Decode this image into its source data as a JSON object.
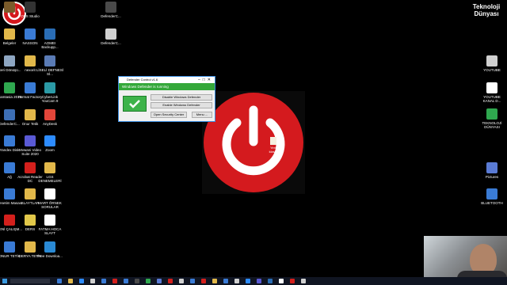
{
  "brand": {
    "line1": "Teknoloji",
    "line2": "Dünyası"
  },
  "desktop_icons": [
    {
      "label": "",
      "color": "#7a5b2a"
    },
    {
      "label": "OBS Studio",
      "color": "#333333"
    },
    {
      "label": "DefenderC...",
      "color": "#4a4a4a"
    },
    {
      "label": "Belgeler",
      "color": "#e2b84a"
    },
    {
      "label": "NASSON",
      "color": "#3a7bd5"
    },
    {
      "label": "AOMEI Backupp...",
      "color": "#2a6db5"
    },
    {
      "label": "DefenderC...",
      "color": "#d0d0d0"
    },
    {
      "label": "Geri Dönüşü...",
      "color": "#8ea6c2"
    },
    {
      "label": "nexorit",
      "color": "#e2b84a"
    },
    {
      "label": "LİSELİ DEFNESİ Sİ...",
      "color": "#5a7bb5"
    },
    {
      "label": "Camtasia 2019",
      "color": "#2fa84f"
    },
    {
      "label": "Format Factory",
      "color": "#3a7bd5"
    },
    {
      "label": "CyberLink YouCam 9",
      "color": "#2b9aa6"
    },
    {
      "label": "DefenderC...",
      "color": "#3d6fb5"
    },
    {
      "label": "Onur Tetik",
      "color": "#e2b84a"
    },
    {
      "label": "AnyDesk",
      "color": "#e3463a"
    },
    {
      "label": "Yandex Disk",
      "color": "#3a7bd5"
    },
    {
      "label": "Mvwani Video Suite 2020",
      "color": "#5a5ad5"
    },
    {
      "label": "Zoom",
      "color": "#2d8cff"
    },
    {
      "label": "Ağ",
      "color": "#3a7bd5"
    },
    {
      "label": "Acrobat Reader DC",
      "color": "#d4201c"
    },
    {
      "label": "LGS DENEMELERİ",
      "color": "#e2b84a"
    },
    {
      "label": "Denetim Masası",
      "color": "#3a7bd5"
    },
    {
      "label": "SLAYTLAR",
      "color": "#e2b84a"
    },
    {
      "label": "MART ÖRNEK SORULAR",
      "color": "#ffffff"
    },
    {
      "label": "YENİ ÇALIŞM...",
      "color": "#d4201c"
    },
    {
      "label": "DERS",
      "color": "#e2c84a"
    },
    {
      "label": "FATMA HOCA SLAYT",
      "color": "#ffffff"
    },
    {
      "label": "ONUR TETİK",
      "color": "#3a7bd5"
    },
    {
      "label": "DERYA TETİK",
      "color": "#e2b84a"
    },
    {
      "label": "Free Downloa...",
      "color": "#2a8ad5"
    }
  ],
  "right_icons": [
    {
      "label": "YOUTUBE",
      "color": "#d0d0d0"
    },
    {
      "label": "YOUTUBE KANAL D...",
      "color": "#ffffff"
    },
    {
      "label": "TEKNOLOJİ DÜNYASI",
      "color": "#2fa84f"
    },
    {
      "label": "Pictures",
      "color": "#5a7bd5"
    },
    {
      "label": "BLUETOOTH",
      "color": "#3a7bd5"
    }
  ],
  "desktop_file": {
    "label": "Yeni klasör"
  },
  "defender_window": {
    "title": "Defender Control v1.6",
    "status": "Windows Defender is running",
    "disable_button": "Disable Windows Defender",
    "enable_button": "Enable Windows Defender",
    "open_button": "Open Security Center",
    "menu_button": "Menu ...",
    "status_color": "#34a83a"
  },
  "taskbar": {
    "icon_colors": [
      "#3a7bd5",
      "#e2b84a",
      "#2d8cff",
      "#d0d0d0",
      "#3a7bd5",
      "#d4201c",
      "#3a7bd5",
      "#4a4a4a",
      "#2fa84f",
      "#5a7bd5",
      "#d4201c",
      "#d0d0d0",
      "#3a7bd5",
      "#d4201c",
      "#e2b84a",
      "#3a7bd5",
      "#d0d0d0",
      "#2d8cff",
      "#5a5ad5",
      "#2a6db5",
      "#ffffff",
      "#d4201c",
      "#d0d0d0"
    ]
  }
}
